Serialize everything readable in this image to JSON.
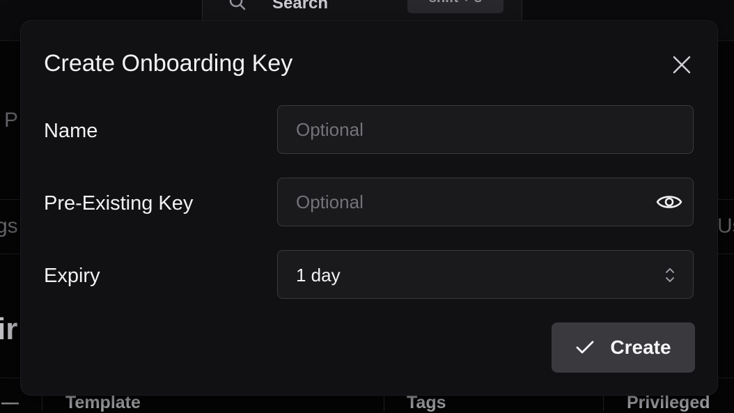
{
  "background": {
    "search": {
      "label": "Search",
      "shortcut": "shift + s"
    },
    "partial_texts": {
      "left_p": "P",
      "left_tab": "gs",
      "right_tab": "Us",
      "heading": "ir",
      "dash": "—"
    },
    "table_headers": [
      "Template",
      "Tags",
      "Privileged"
    ]
  },
  "modal": {
    "title": "Create Onboarding Key",
    "close_icon": "close-icon",
    "fields": {
      "name": {
        "label": "Name",
        "value": "",
        "placeholder": "Optional"
      },
      "pre_existing_key": {
        "label": "Pre-Existing Key",
        "value": "",
        "placeholder": "Optional",
        "toggle_icon": "eye-icon"
      },
      "expiry": {
        "label": "Expiry",
        "selected": "1 day",
        "icon": "chevron-up-down-icon"
      }
    },
    "create_button": {
      "label": "Create",
      "icon": "check-icon"
    }
  },
  "colors": {
    "modal_bg": "#111114",
    "field_bg": "#1a1a1d",
    "field_border": "#3a3a3f",
    "button_bg": "#3a3a3e",
    "text": "#f2f2f4",
    "placeholder": "#737379"
  }
}
